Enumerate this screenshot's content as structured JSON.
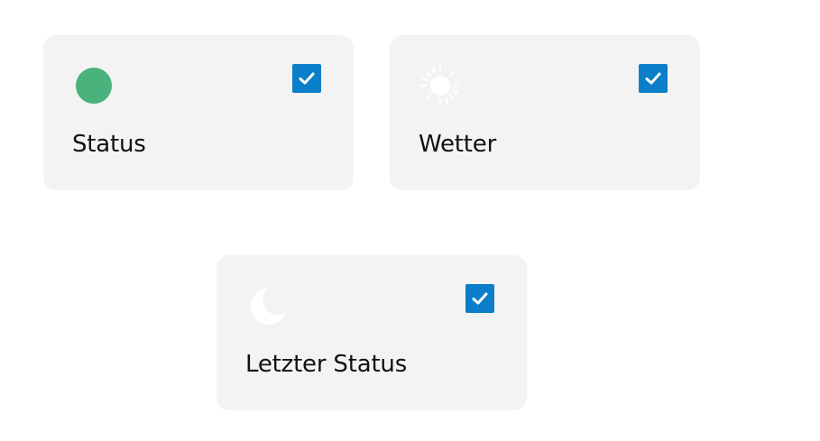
{
  "cards": [
    {
      "label": "Status",
      "icon": "status-dot-icon",
      "icon_color": "#4ab27d",
      "checked": true
    },
    {
      "label": "Wetter",
      "icon": "sun-icon",
      "icon_color": "#ffffff",
      "checked": true
    },
    {
      "label": "Letzter Status",
      "icon": "moon-icon",
      "icon_color": "#ffffff",
      "checked": true
    }
  ],
  "colors": {
    "card_background": "#f3f3f3",
    "checkbox_accent": "#0a7ec8",
    "text": "#111111"
  }
}
